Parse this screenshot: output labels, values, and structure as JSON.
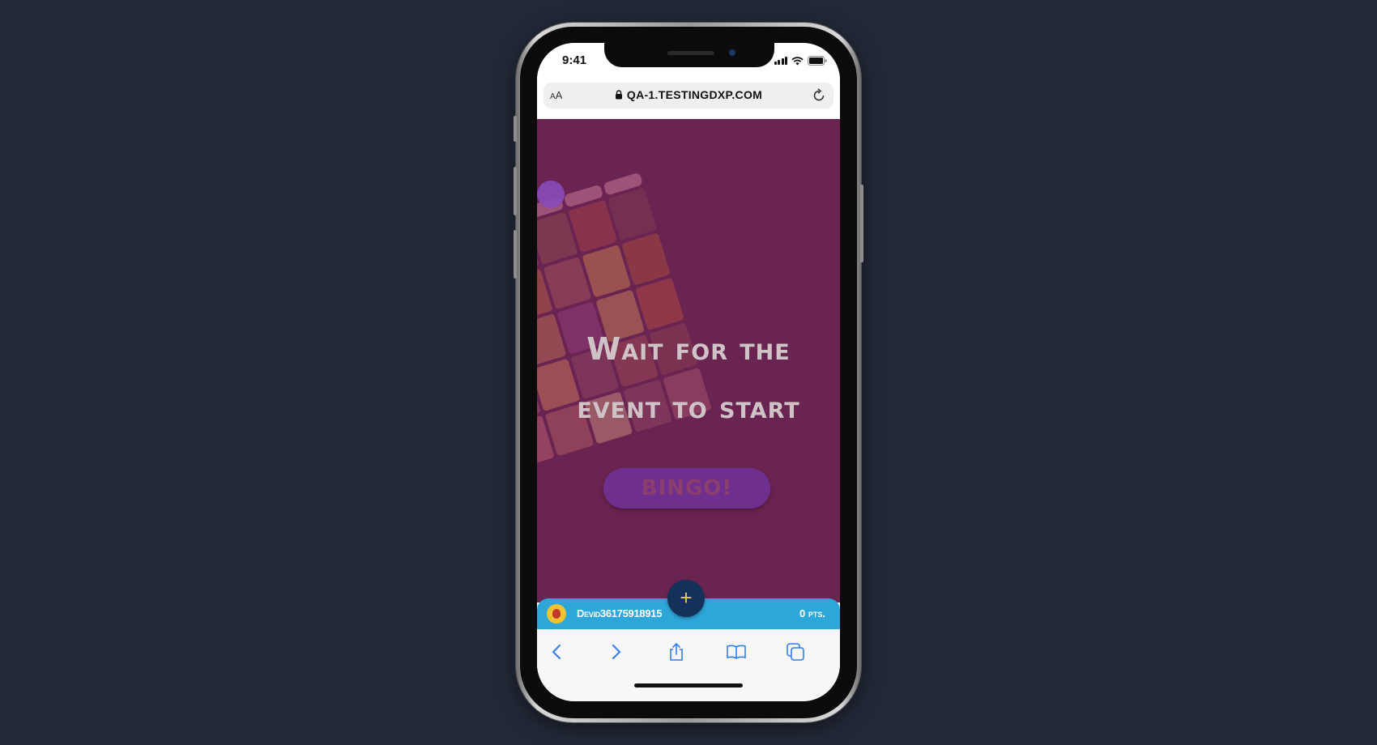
{
  "status_bar": {
    "time": "9:41"
  },
  "browser": {
    "text_size_label": "AA",
    "url": "QA-1.TESTINGDXP.COM"
  },
  "event": {
    "message_line1": "Wait for the",
    "message_line2": "event to start",
    "bingo_button_label": "BINGO!"
  },
  "user_bar": {
    "add_button_symbol": "+",
    "username": "Devid36175918915",
    "points": "0 pts."
  },
  "toolbar": {
    "items": [
      "back-icon",
      "forward-icon",
      "share-icon",
      "bookmarks-icon",
      "tabs-icon"
    ]
  },
  "colors": {
    "page_background": "#222837",
    "webview_overlay": "#6a2451",
    "user_bar": "#2da7da",
    "fab": "#14315a",
    "fab_plus": "#f5c84b",
    "ios_blue": "#2f7cf6"
  }
}
